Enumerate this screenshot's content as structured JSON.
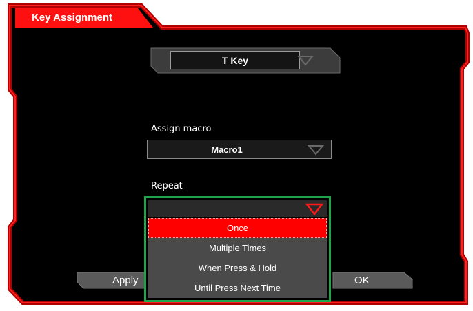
{
  "window": {
    "tab_title": "Key Assignment"
  },
  "key_select": {
    "value": "T Key"
  },
  "macro": {
    "label": "Assign macro",
    "value": "Macro1"
  },
  "repeat": {
    "label": "Repeat",
    "value": "",
    "options": [
      "Once",
      "Multiple Times",
      "When Press & Hold",
      "Until Press Next Time"
    ],
    "selected_index": 0
  },
  "buttons": {
    "apply": "Apply",
    "ok": "OK"
  },
  "colors": {
    "accent": "#ff0000",
    "highlight_border": "#1ea54a",
    "background": "#000000"
  },
  "icons": {
    "dropdown_arrow": "triangle-down-icon"
  }
}
